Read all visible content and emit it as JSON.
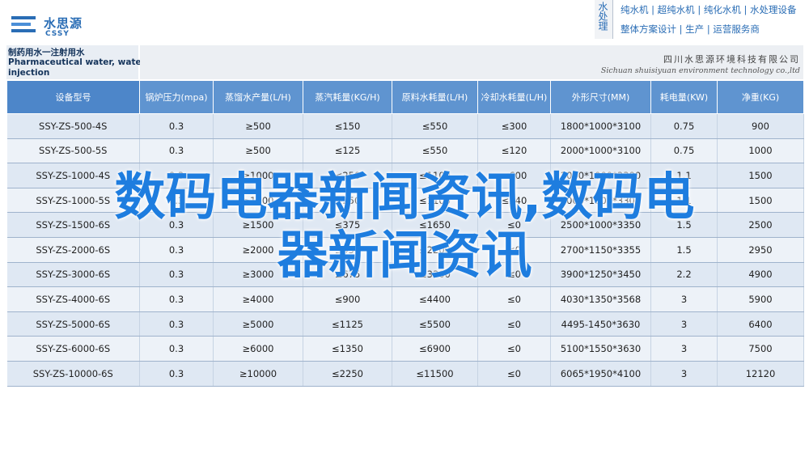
{
  "logo": {
    "name": "水思源",
    "en": "CSSY"
  },
  "brand": {
    "vertical": "水处理",
    "line1": "纯水机 | 超纯水机 | 纯化水机 | 水处理设备",
    "line2": "整体方案设计 | 生产 | 运营服务商"
  },
  "product": {
    "title_cn": "制药用水一注射用水",
    "title_en_1": "Pharmaceutical water, water for",
    "title_en_2": "injection"
  },
  "company": {
    "name_cn": "四川水思源环境科技有限公司",
    "name_en": "Sichuan shuisiyuan environment technology co.,ltd"
  },
  "table": {
    "headers": [
      "设备型号",
      "锅炉压力(mpa)",
      "蒸馏水产量(L/H)",
      "蒸汽耗量(KG/H)",
      "原料水耗量(L/H)",
      "冷却水耗量(L/H)",
      "外形尺寸(MM)",
      "耗电量(KW)",
      "净重(KG)"
    ],
    "rows": [
      [
        "SSY-ZS-500-4S",
        "0.3",
        "≥500",
        "≤150",
        "≤550",
        "≤300",
        "1800*1000*3100",
        "0.75",
        "900"
      ],
      [
        "SSY-ZS-500-5S",
        "0.3",
        "≥500",
        "≤125",
        "≤550",
        "≤120",
        "2000*1000*3100",
        "0.75",
        "1000"
      ],
      [
        "SSY-ZS-1000-4S",
        "0.3",
        "≥1000",
        "≤250",
        "≤1100",
        "≤600",
        "2000*1000*3300",
        "1.1",
        "1500"
      ],
      [
        "SSY-ZS-1000-5S",
        "0.3",
        "≥1000",
        "≤250",
        "≤1100",
        "≤240",
        "2000*1000*3300",
        "1.1",
        "1500"
      ],
      [
        "SSY-ZS-1500-6S",
        "0.3",
        "≥1500",
        "≤375",
        "≤1650",
        "≤0",
        "2500*1000*3350",
        "1.5",
        "2500"
      ],
      [
        "SSY-ZS-2000-6S",
        "0.3",
        "≥2000",
        "≤450",
        "≤2200",
        "≤0",
        "2700*1150*3355",
        "1.5",
        "2950"
      ],
      [
        "SSY-ZS-3000-6S",
        "0.3",
        "≥3000",
        "≤675",
        "≤3300",
        "≤0",
        "3900*1250*3450",
        "2.2",
        "4900"
      ],
      [
        "SSY-ZS-4000-6S",
        "0.3",
        "≥4000",
        "≤900",
        "≤4400",
        "≤0",
        "4030*1350*3568",
        "3",
        "5900"
      ],
      [
        "SSY-ZS-5000-6S",
        "0.3",
        "≥5000",
        "≤1125",
        "≤5500",
        "≤0",
        "4495-1450*3630",
        "3",
        "6400"
      ],
      [
        "SSY-ZS-6000-6S",
        "0.3",
        "≥6000",
        "≤1350",
        "≤6900",
        "≤0",
        "5100*1550*3630",
        "3",
        "7500"
      ],
      [
        "SSY-ZS-10000-6S",
        "0.3",
        "≥10000",
        "≤2250",
        "≤11500",
        "≤0",
        "6065*1950*4100",
        "3",
        "12120"
      ]
    ]
  },
  "overlay": {
    "line1": "数码电器新闻资讯,数码电",
    "line2": "器新闻资讯"
  }
}
